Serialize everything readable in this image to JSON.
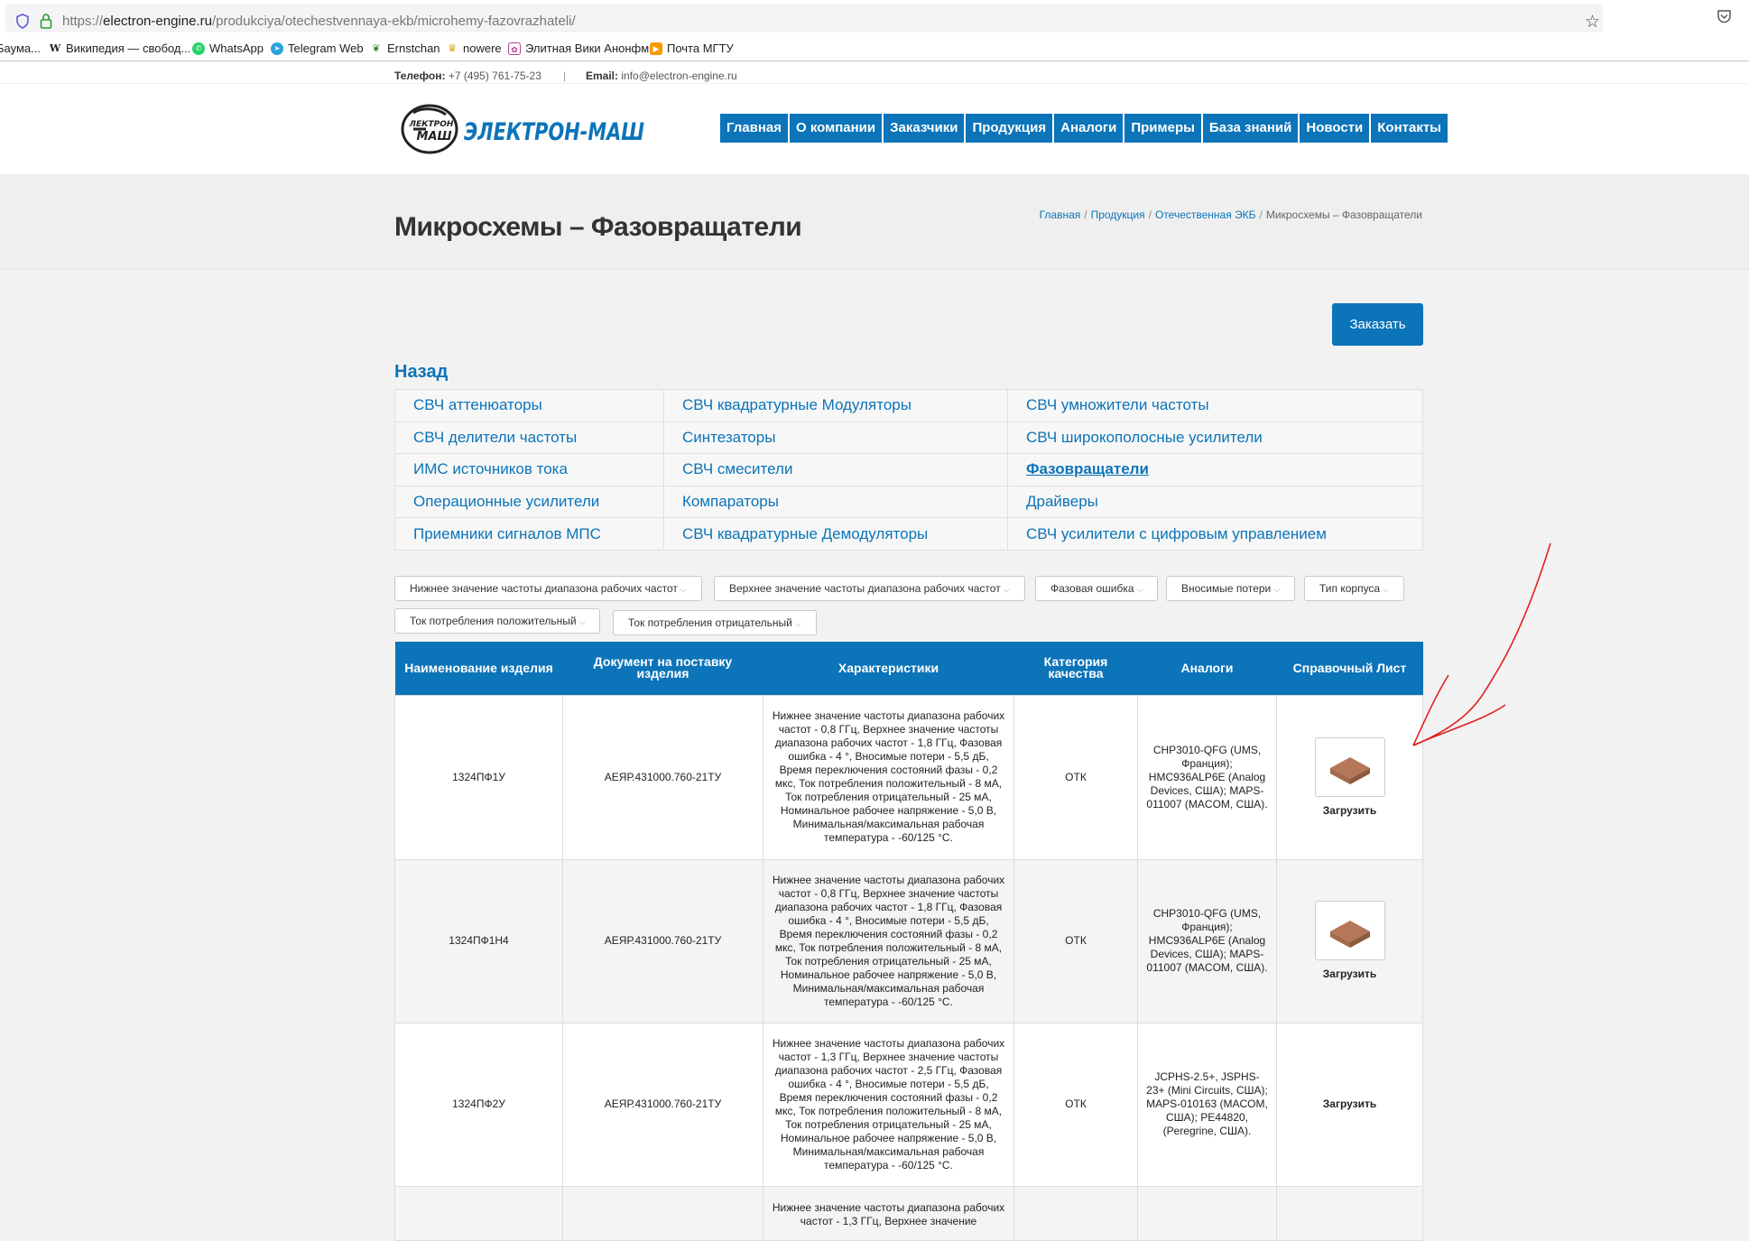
{
  "browser": {
    "url_scheme": "https://",
    "url_host": "electron-engine.ru",
    "url_path": "/produkciya/otechestvennaya-ekb/microhemy-fazovrazhateli/",
    "bookmarks": [
      {
        "label": "Баума...",
        "icon": "doc-icon"
      },
      {
        "label": "Википедия — свобод...",
        "icon": "wikipedia-icon"
      },
      {
        "label": "WhatsApp",
        "icon": "whatsapp-icon"
      },
      {
        "label": "Telegram Web",
        "icon": "telegram-icon"
      },
      {
        "label": "Ernstchan",
        "icon": "ernstchan-icon"
      },
      {
        "label": "nowere",
        "icon": "nowere-icon"
      },
      {
        "label": "Элитная Вики Анонфм",
        "icon": "wiki-icon"
      },
      {
        "label": "Почта МГТУ",
        "icon": "mail-icon"
      }
    ]
  },
  "topbar": {
    "phone_label": "Телефон:",
    "phone": "+7 (495) 761-75-23",
    "divider": "|",
    "email_label": "Email:",
    "email": "info@electron-engine.ru"
  },
  "logo": {
    "text_main": "ЭЛЕКТРОН-МАШ",
    "emblem_top": "ЛЕКТРОН",
    "emblem_bottom": "МАШ"
  },
  "nav": [
    "Главная",
    "О компании",
    "Заказчики",
    "Продукция",
    "Аналоги",
    "Примеры",
    "База знаний",
    "Новости",
    "Контакты"
  ],
  "page": {
    "title": "Микросхемы – Фазовращатели",
    "breadcrumb": [
      "Главная",
      "Продукция",
      "Отечественная ЭКБ",
      "Микросхемы – Фазовращатели"
    ],
    "order_button": "Заказать",
    "back": "Назад"
  },
  "categories": [
    [
      "СВЧ аттенюаторы",
      "СВЧ квадратурные Модуляторы",
      "СВЧ умножители частоты"
    ],
    [
      "СВЧ делители частоты",
      "Синтезаторы",
      "СВЧ широкополосные усилители"
    ],
    [
      "ИМС источников тока",
      "СВЧ смесители",
      "Фазовращатели"
    ],
    [
      "Операционные усилители",
      "Компараторы",
      "Драйверы"
    ],
    [
      "Приемники сигналов МПС",
      "СВЧ квадратурные Демодуляторы",
      "СВЧ усилители с цифровым управлением"
    ]
  ],
  "filters": [
    "Нижнее значение частоты диапазона рабочих частот",
    "Верхнее значение частоты диапазона рабочих частот",
    "Фазовая ошибка",
    "Вносимые потери",
    "Тип корпуса",
    "Ток потребления положительный",
    "Ток потребления отрицательный"
  ],
  "table": {
    "headers": [
      "Наименование изделия",
      "Документ на поставку изделия",
      "Характеристики",
      "Категория качества",
      "Аналоги",
      "Справочный Лист"
    ],
    "rows": [
      {
        "name": "1324ПФ1У",
        "doc": "АЕЯР.431000.760-21ТУ",
        "specs": "Нижнее значение частоты диапазона рабочих частот - 0,8 ГГц, Верхнее значение частоты диапазона рабочих частот - 1,8 ГГц, Фазовая ошибка - 4 °, Вносимые потери - 5,5 дБ, Время переключения состояний фазы - 0,2 мкс, Ток потребления положительный - 8 мА, Ток потребления отрицательный - 25 мА, Номинальное рабочее напряжение - 5,0 В, Минимальная/максимальная рабочая температура - -60/125 °С.",
        "quality": "ОТК",
        "analogs": "CHP3010-QFG (UMS, Франция); HMC936ALP6E (Analog Devices, США); MAPS-011007 (MACOM, США).",
        "download": "Загрузить"
      },
      {
        "name": "1324ПФ1Н4",
        "doc": "АЕЯР.431000.760-21ТУ",
        "specs": "Нижнее значение частоты диапазона рабочих частот - 0,8 ГГц, Верхнее значение частоты диапазона рабочих частот - 1,8 ГГц, Фазовая ошибка - 4 °, Вносимые потери - 5,5 дБ, Время переключения состояний фазы - 0,2 мкс, Ток потребления положительный - 8 мА, Ток потребления отрицательный - 25 мА, Номинальное рабочее напряжение - 5,0 В, Минимальная/максимальная рабочая температура - -60/125 °С.",
        "quality": "ОТК",
        "analogs": "CHP3010-QFG (UMS, Франция); HMC936ALP6E (Analog Devices, США); MAPS-011007 (MACOM, США).",
        "download": "Загрузить"
      },
      {
        "name": "1324ПФ2У",
        "doc": "АЕЯР.431000.760-21ТУ",
        "specs": "Нижнее значение частоты диапазона рабочих частот - 1,3 ГГц, Верхнее значение частоты диапазона рабочих частот - 2,5 ГГц, Фазовая ошибка - 4 °, Вносимые потери - 5,5 дБ, Время переключения состояний фазы - 0,2 мкс, Ток потребления положительный - 8 мА, Ток потребления отрицательный - 25 мА, Номинальное рабочее напряжение - 5,0 В, Минимальная/максимальная рабочая температура - -60/125 °С.",
        "quality": "ОТК",
        "analogs": "JCPHS-2.5+, JSPHS-23+ (Mini Circuits, США); MAPS-010163 (MACOM, США); PE44820, (Peregrine, США).",
        "download": "Загрузить"
      },
      {
        "name": "",
        "doc": "",
        "specs": "Нижнее значение частоты диапазона рабочих частот - 1,3 ГГц, Верхнее значение",
        "quality": "",
        "analogs": "",
        "download": ""
      }
    ]
  },
  "colors": {
    "brand_blue": "#0c74b9",
    "annotation_red": "#e02020"
  }
}
